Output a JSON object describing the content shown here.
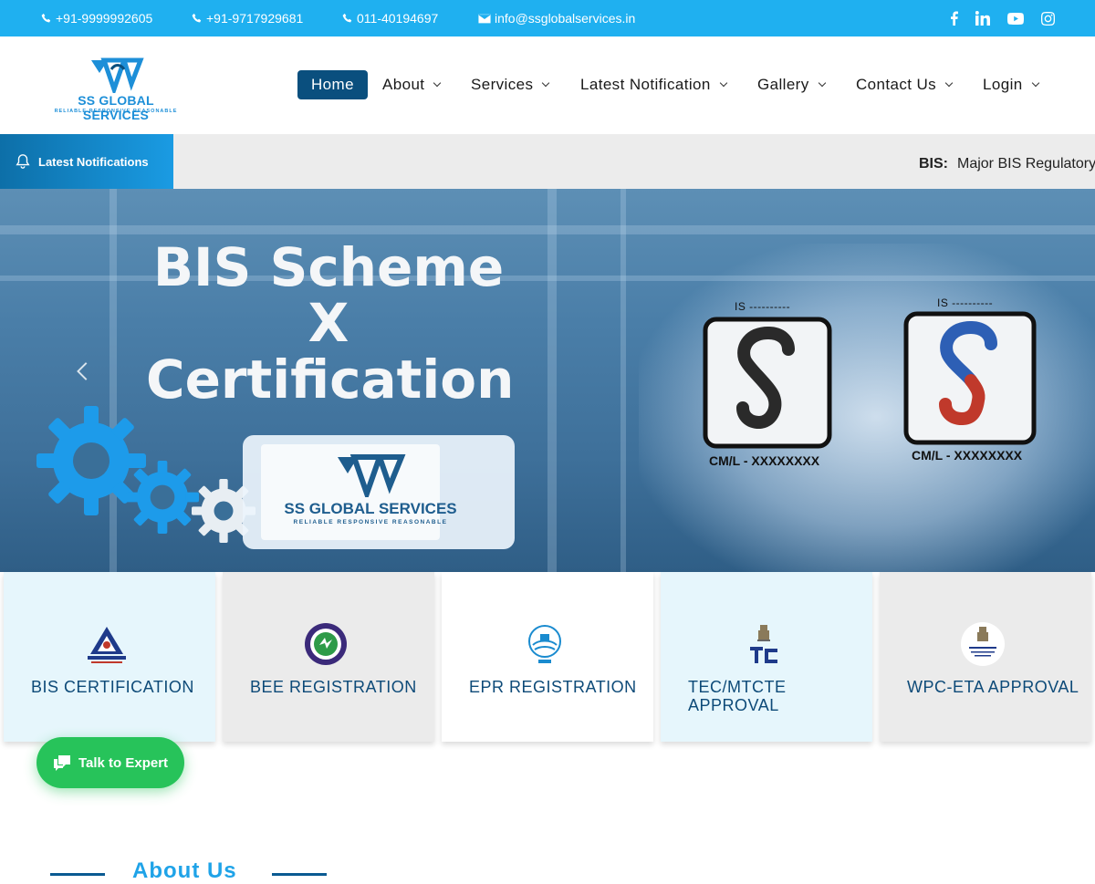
{
  "topbar": {
    "phone1": "+91-9999992605",
    "phone2": "+91-9717929681",
    "phone3": "011-40194697",
    "email": "info@ssglobalservices.in",
    "social": [
      "facebook-icon",
      "linkedin-icon",
      "youtube-icon",
      "instagram-icon"
    ]
  },
  "header": {
    "brand": "SS GLOBAL SERVICES",
    "tagline": "RELIABLE RESPONSIVE REASONABLE",
    "nav": {
      "home": "Home",
      "about": "About",
      "services": "Services",
      "latest": "Latest Notification",
      "gallery": "Gallery",
      "contact": "Contact Us",
      "login": "Login"
    }
  },
  "notifications": {
    "label": "Latest Notifications",
    "ticker_tag": "BIS:",
    "ticker_text": "Major BIS Regulatory"
  },
  "hero": {
    "line1": "BIS Scheme",
    "line2": "X",
    "line3": "Certification",
    "card_brand": "SS GLOBAL SERVICES",
    "card_tagline": "RELIABLE RESPONSIVE REASONABLE",
    "mark_is": "IS ----------",
    "mark_cml": "CM/L - XXXXXXXX"
  },
  "services": [
    {
      "title": "BIS CERTIFICATION",
      "bg": "#e6f6fc"
    },
    {
      "title": "BEE REGISTRATION",
      "bg": "#ebebeb"
    },
    {
      "title": "EPR REGISTRATION",
      "bg": "#ffffff"
    },
    {
      "title": "TEC/MTCTE APPROVAL",
      "bg": "#e6f6fc"
    },
    {
      "title": "WPC-ETA APPROVAL",
      "bg": "#ebebeb"
    }
  ],
  "expert_button": "Talk to Expert",
  "about_heading": "About Us",
  "colors": {
    "topbar": "#1fb0f0",
    "nav_active": "#0a4f7e",
    "service_text": "#0d4a78",
    "expert": "#27c35a"
  }
}
